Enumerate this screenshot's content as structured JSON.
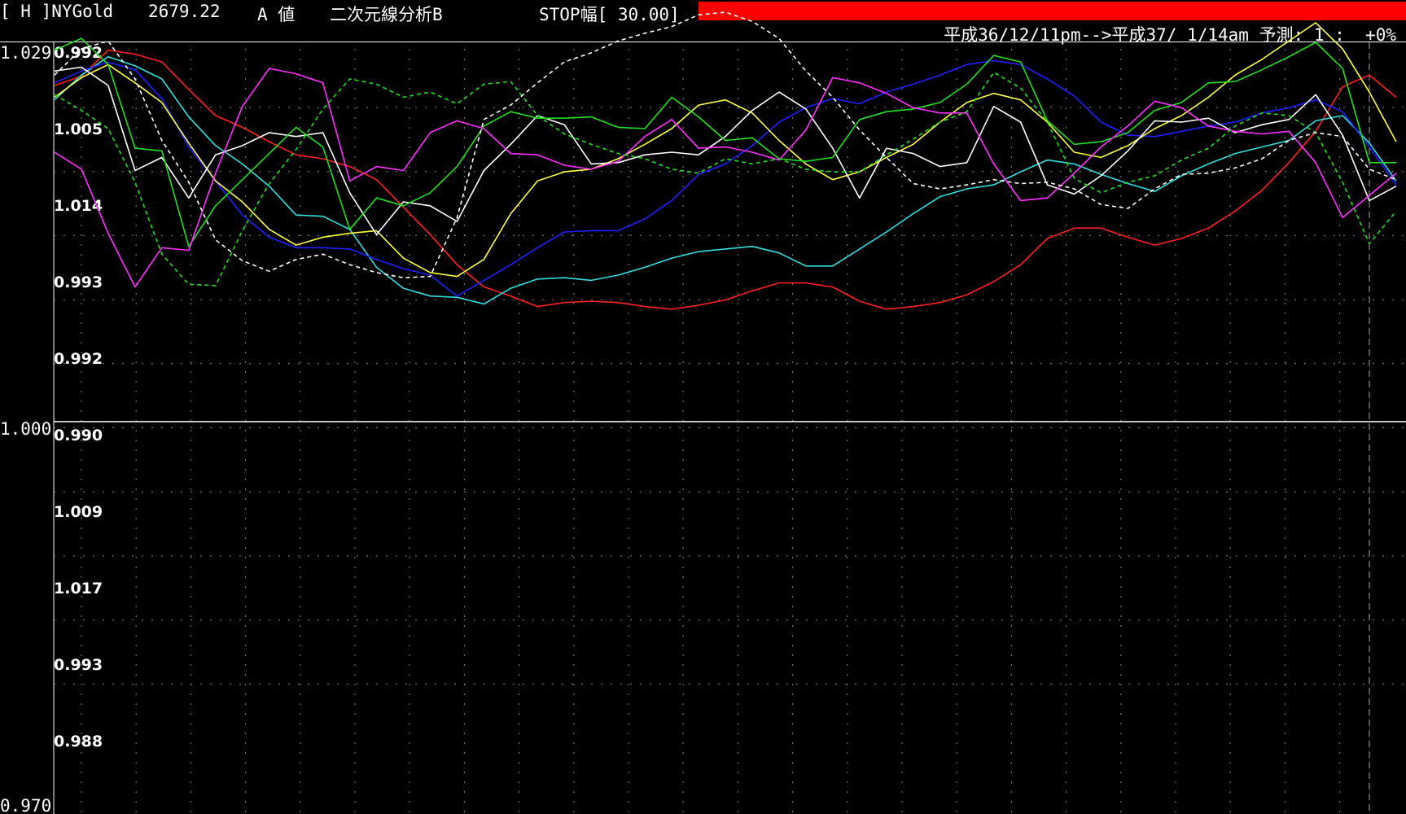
{
  "header": {
    "symbol": "[ H ]NYGold",
    "price": "2679.22",
    "value_type": "A 値",
    "analysis": "二次元線分析B",
    "stop_width": "STOP幅[ 30.00]",
    "accent_color": "#ff0000",
    "period": "平成36/12/11pm-->平成37/ 1/14am 予測: 1 :  +0%"
  },
  "chart_data": {
    "type": "line",
    "x_count": 51,
    "ylim": [
      0.97,
      1.029
    ],
    "y_ticks": [
      "1.029",
      "1.000",
      "0.970"
    ],
    "baseline": 1.0,
    "series_labels": [
      "0.992",
      "1.005",
      "1.014",
      "0.993",
      "0.992",
      "0.990",
      "1.009",
      "1.017",
      "0.993",
      "0.988"
    ],
    "grid": "dotted",
    "series": [
      {
        "color": "#ff2020",
        "dashed": false,
        "values": [
          1.0257,
          1.0264,
          1.0284,
          1.0281,
          1.0275,
          1.0254,
          1.0234,
          1.0225,
          1.0214,
          1.0204,
          1.0201,
          1.0195,
          1.0185,
          1.0164,
          1.0143,
          1.012,
          1.0103,
          1.0096,
          1.0088,
          1.0091,
          1.0092,
          1.0091,
          1.0088,
          1.0086,
          1.0089,
          1.0093,
          1.01,
          1.0106,
          1.0106,
          1.0103,
          1.0092,
          1.0086,
          1.0088,
          1.0091,
          1.0097,
          1.0107,
          1.012,
          1.014,
          1.0148,
          1.0148,
          1.0141,
          1.0135,
          1.014,
          1.0148,
          1.0161,
          1.0177,
          1.0198,
          1.0222,
          1.0256,
          1.0265,
          1.0248
        ]
      },
      {
        "color": "#30e0e0",
        "dashed": false,
        "values": [
          1.0246,
          1.0265,
          1.0279,
          1.0272,
          1.0262,
          1.0233,
          1.0211,
          1.0197,
          1.018,
          1.0158,
          1.0157,
          1.0147,
          1.0118,
          1.0102,
          1.0096,
          1.0095,
          1.009,
          1.0102,
          1.0109,
          1.011,
          1.0108,
          1.0112,
          1.0118,
          1.0125,
          1.013,
          1.0132,
          1.0134,
          1.0129,
          1.0119,
          1.0119,
          1.0132,
          1.0145,
          1.0159,
          1.0172,
          1.0178,
          1.0181,
          1.0191,
          1.02,
          1.0197,
          1.0189,
          1.0182,
          1.0176,
          1.0188,
          1.0197,
          1.0205,
          1.021,
          1.0215,
          1.023,
          1.0234,
          1.0213,
          1.0184
        ]
      },
      {
        "color": "#2020ff",
        "dashed": false,
        "values": [
          1.0259,
          1.0268,
          1.0275,
          1.0269,
          1.0247,
          1.021,
          1.0184,
          1.0158,
          1.0141,
          1.0133,
          1.0133,
          1.0132,
          1.0124,
          1.0117,
          1.0112,
          1.0096,
          1.0108,
          1.012,
          1.0133,
          1.0145,
          1.0146,
          1.0146,
          1.0155,
          1.0169,
          1.0189,
          1.0197,
          1.0211,
          1.0229,
          1.024,
          1.0247,
          1.0243,
          1.0252,
          1.0258,
          1.0265,
          1.0273,
          1.0276,
          1.0273,
          1.0262,
          1.0249,
          1.0229,
          1.0219,
          1.0218,
          1.0222,
          1.0226,
          1.0229,
          1.0236,
          1.024,
          1.0246,
          1.0237,
          1.021,
          1.0181
        ]
      },
      {
        "color": "#ffff40",
        "dashed": false,
        "values": [
          1.0248,
          1.0263,
          1.0273,
          1.0259,
          1.0244,
          1.0213,
          1.0184,
          1.0168,
          1.0147,
          1.0135,
          1.0141,
          1.0144,
          1.0146,
          1.0125,
          1.0114,
          1.0111,
          1.0124,
          1.0159,
          1.0184,
          1.0191,
          1.0193,
          1.0201,
          1.0212,
          1.0224,
          1.0242,
          1.0246,
          1.0236,
          1.0215,
          1.0197,
          1.0185,
          1.0191,
          1.0202,
          1.0212,
          1.0229,
          1.0244,
          1.0251,
          1.0246,
          1.0229,
          1.0206,
          1.0202,
          1.0211,
          1.0224,
          1.0234,
          1.0248,
          1.0265,
          1.0277,
          1.0291,
          1.0305,
          1.0285,
          1.0252,
          1.0214
        ]
      },
      {
        "color": "#ffffff",
        "dashed": false,
        "values": [
          1.0268,
          1.0271,
          1.0257,
          1.0192,
          1.0202,
          1.0171,
          1.0204,
          1.0211,
          1.0221,
          1.0218,
          1.0221,
          1.0175,
          1.0143,
          1.0168,
          1.0165,
          1.0153,
          1.0192,
          1.0212,
          1.0234,
          1.0227,
          1.0197,
          1.0198,
          1.0204,
          1.0206,
          1.0204,
          1.0218,
          1.0238,
          1.0252,
          1.0239,
          1.0209,
          1.0171,
          1.0209,
          1.0205,
          1.0195,
          1.0198,
          1.0241,
          1.0229,
          1.0181,
          1.0174,
          1.0188,
          1.0207,
          1.023,
          1.0229,
          1.0232,
          1.0221,
          1.0227,
          1.0231,
          1.025,
          1.0219,
          1.0169,
          1.018
        ]
      },
      {
        "color": "#20e020",
        "dashed": false,
        "values": [
          1.0284,
          1.0293,
          1.0273,
          1.0209,
          1.0207,
          1.0134,
          1.0165,
          1.0185,
          1.0205,
          1.0225,
          1.021,
          1.0147,
          1.0171,
          1.0165,
          1.0175,
          1.0195,
          1.0226,
          1.0237,
          1.0232,
          1.0232,
          1.0233,
          1.0225,
          1.0224,
          1.0248,
          1.0233,
          1.0215,
          1.0217,
          1.0201,
          1.0199,
          1.0202,
          1.0231,
          1.0237,
          1.0239,
          1.0244,
          1.0258,
          1.028,
          1.0275,
          1.023,
          1.0212,
          1.0214,
          1.0221,
          1.0238,
          1.0244,
          1.0259,
          1.026,
          1.0269,
          1.0279,
          1.029,
          1.027,
          1.0198,
          1.0198
        ]
      },
      {
        "color": "#ff30ff",
        "dashed": false,
        "values": [
          1.0206,
          1.0193,
          1.0144,
          1.0103,
          1.0133,
          1.0131,
          1.019,
          1.0241,
          1.027,
          1.0266,
          1.0259,
          1.0184,
          1.0195,
          1.0192,
          1.0221,
          1.023,
          1.0224,
          1.0205,
          1.0204,
          1.0196,
          1.0193,
          1.0199,
          1.0218,
          1.0231,
          1.0209,
          1.021,
          1.0206,
          1.02,
          1.0223,
          1.0263,
          1.0259,
          1.0251,
          1.024,
          1.0236,
          1.0236,
          1.0197,
          1.0169,
          1.0171,
          1.019,
          1.021,
          1.0226,
          1.0245,
          1.024,
          1.0226,
          1.0222,
          1.022,
          1.0222,
          1.0198,
          1.0156,
          1.0173,
          1.019
        ]
      },
      {
        "color": "#20e020",
        "dashed": true,
        "values": [
          1.025,
          1.0238,
          1.0224,
          1.0183,
          1.0128,
          1.0105,
          1.0104,
          1.0146,
          1.0182,
          1.0208,
          1.0239,
          1.0262,
          1.0258,
          1.0248,
          1.0252,
          1.0243,
          1.0258,
          1.026,
          1.0234,
          1.022,
          1.0212,
          1.0205,
          1.0201,
          1.0193,
          1.019,
          1.0201,
          1.0197,
          1.0201,
          1.0193,
          1.0191,
          1.0191,
          1.0204,
          1.0216,
          1.0229,
          1.0237,
          1.0267,
          1.0255,
          1.0229,
          1.0186,
          1.0175,
          1.0183,
          1.0188,
          1.02,
          1.0209,
          1.0226,
          1.0236,
          1.0234,
          1.0221,
          1.0183,
          1.0136,
          1.0161
        ]
      },
      {
        "color": "#ffffff",
        "dashed": true,
        "values": [
          1.0265,
          1.0285,
          1.0291,
          1.0262,
          1.0215,
          1.0183,
          1.0139,
          1.0123,
          1.0115,
          1.0124,
          1.0128,
          1.012,
          1.0114,
          1.011,
          1.0111,
          1.0156,
          1.0231,
          1.0242,
          1.0259,
          1.0275,
          1.0282,
          1.0291,
          1.0297,
          1.0302,
          1.0311,
          1.0313,
          1.0306,
          1.0293,
          1.0268,
          1.0248,
          1.0223,
          1.0202,
          1.0182,
          1.0178,
          1.0181,
          1.0185,
          1.0182,
          1.0183,
          1.0178,
          1.0166,
          1.0163,
          1.0178,
          1.0189,
          1.019,
          1.0194,
          1.0201,
          1.0215,
          1.0221,
          1.0218,
          1.0193,
          1.0185
        ]
      }
    ]
  }
}
